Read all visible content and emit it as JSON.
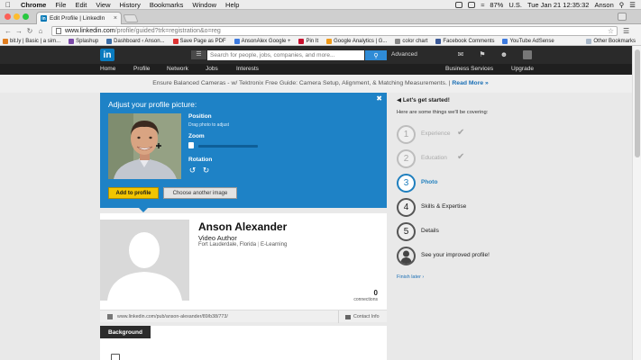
{
  "menubar": {
    "app": "Chrome",
    "items": [
      "File",
      "Edit",
      "View",
      "History",
      "Bookmarks",
      "Window",
      "Help"
    ],
    "battery": "87%",
    "locale": "U.S.",
    "clock": "Tue Jan 21  12:35:32",
    "user": "Anson"
  },
  "browser": {
    "tab_title": "Edit Profile | LinkedIn",
    "url_host": "www.linkedin.com",
    "url_path": "/profile/guided?trk=registration&o=reg",
    "bookmarks": [
      {
        "label": "bit.ly | Basic | a sim...",
        "color": "#e07d1f"
      },
      {
        "label": "Splashup",
        "color": "#7b4aa8"
      },
      {
        "label": "Dashboard ‹ Anson...",
        "color": "#3b6ea8"
      },
      {
        "label": "Save Page as PDF",
        "color": "#d33"
      },
      {
        "label": "AnsonAlex Google +",
        "color": "#3d7be0"
      },
      {
        "label": "Pin It",
        "color": "#c8102e"
      },
      {
        "label": "Google Analytics | G...",
        "color": "#f09a1a"
      },
      {
        "label": "color chart",
        "color": "#888"
      },
      {
        "label": "Facebook Comments",
        "color": "#3b5998"
      },
      {
        "label": "YouTube AdSense",
        "color": "#3d7be0"
      }
    ],
    "other_bookmarks": "Other Bookmarks"
  },
  "linkedin": {
    "logo": "in",
    "search_placeholder": "Search for people, jobs, companies, and more...",
    "advanced": "Advanced",
    "nav": [
      "Home",
      "Profile",
      "Network",
      "Jobs",
      "Interests"
    ],
    "nav_right": [
      "Business Services",
      "Upgrade"
    ],
    "ad_text": "Ensure Balanced Cameras - w/ Tektronix Free Guide: Camera Setup, Alignment, & Matching Measurements.",
    "ad_more": "Read More »"
  },
  "picture_panel": {
    "title": "Adjust your profile picture:",
    "position_label": "Position",
    "position_hint": "Drag photo to adjust",
    "zoom_label": "Zoom",
    "rotation_label": "Rotation",
    "add_button": "Add to profile",
    "choose_button": "Choose another image",
    "zoom_level": 0.0
  },
  "profile": {
    "name": "Anson Alexander",
    "headline": "Video Author",
    "location": "Fort Lauderdale, Florida",
    "industry": "E-Learning",
    "connections_count": "0",
    "connections_label": "connections",
    "public_url": "www.linkedin.com/pub/anson-alexander/89/b38/773/",
    "contact_info": "Contact Info",
    "background_tab": "Background"
  },
  "steps": {
    "title": "Let's get started!",
    "subtitle": "Here are some things we'll be covering:",
    "items": [
      {
        "num": "1",
        "label": "Experience",
        "state": "done"
      },
      {
        "num": "2",
        "label": "Education",
        "state": "done"
      },
      {
        "num": "3",
        "label": "Photo",
        "state": "active"
      },
      {
        "num": "4",
        "label": "Skills & Expertise",
        "state": "todo"
      },
      {
        "num": "5",
        "label": "Details",
        "state": "todo"
      },
      {
        "num": "",
        "label": "See your improved profile!",
        "state": "final"
      }
    ],
    "finish_later": "Finish later ›"
  },
  "colors": {
    "linkedin_blue": "#1e82c6",
    "add_button_yellow": "#f2c500",
    "header_dark": "#2a2a2a"
  }
}
